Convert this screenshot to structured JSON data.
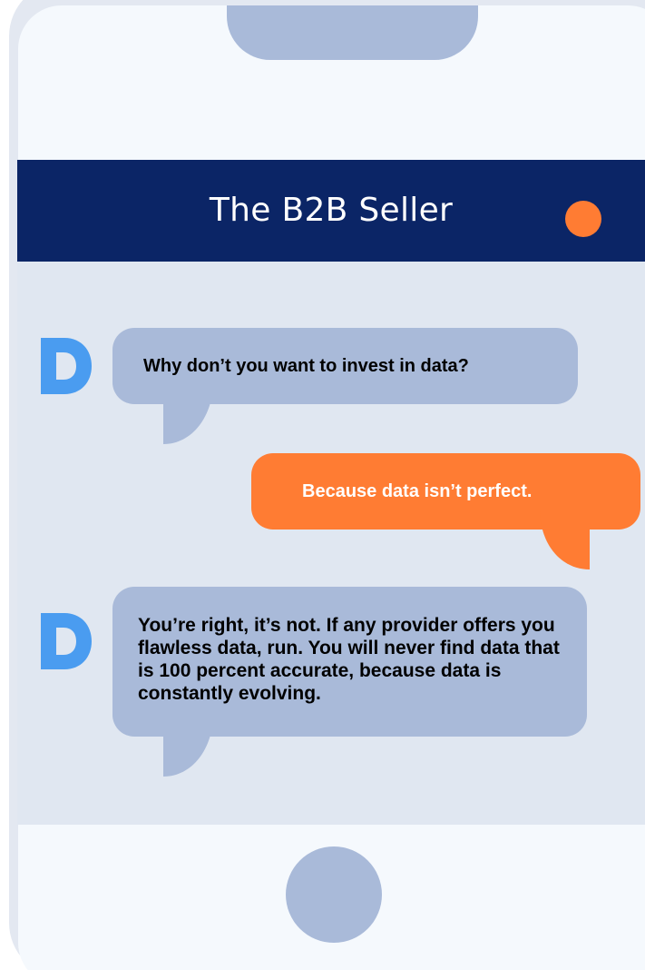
{
  "header": {
    "title": "The B2B Seller"
  },
  "messages": [
    {
      "sender": "bot",
      "text": "Why don’t you want to invest in data?"
    },
    {
      "sender": "user",
      "text": "Because data isn’t perfect."
    },
    {
      "sender": "bot",
      "text": "You’re right, it’s not. If any provider offers you flawless data, run. You will never find data that is 100 percent accurate, because data is constantly evolving."
    }
  ],
  "colors": {
    "header_bg": "#0b2566",
    "accent_orange": "#ff7c33",
    "bubble_blue": "#a9bad9",
    "chat_bg": "#e0e7f1",
    "logo_blue": "#4a9cf0"
  },
  "icons": {
    "bot_avatar": "d-logo-icon",
    "status_indicator": "status-dot-icon"
  }
}
